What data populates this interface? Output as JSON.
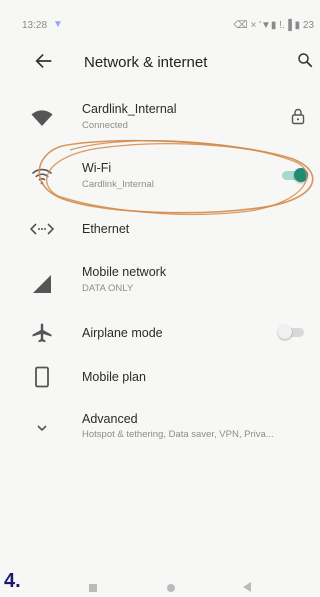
{
  "status_bar": {
    "time": "13:28",
    "right_text": "⌫ × '▼▮ !.▐ ▮ 23"
  },
  "app_bar": {
    "back_icon": "arrow-back-icon",
    "title": "Network & internet",
    "search_icon": "search-icon"
  },
  "items": [
    {
      "title": "Cardlink_Internal",
      "subtitle": "Connected",
      "icon": "wifi-filled-icon",
      "trailing": "lock-icon"
    },
    {
      "title": "Wi-Fi",
      "subtitle": "Cardlink_Internal",
      "icon": "wifi-icon",
      "toggle": true
    },
    {
      "title": "Ethernet",
      "subtitle": "",
      "icon": "ethernet-icon"
    },
    {
      "title": "Mobile network",
      "subtitle": "DATA ONLY",
      "icon": "cellular-signal-icon"
    },
    {
      "title": "Airplane mode",
      "subtitle": "",
      "icon": "airplane-icon",
      "toggle": false
    },
    {
      "title": "Mobile plan",
      "subtitle": "",
      "icon": "phone-outline-icon"
    },
    {
      "title": "Advanced",
      "subtitle": "Hotspot & tethering, Data saver, VPN, Priva...",
      "icon": "chevron-down-icon"
    }
  ],
  "page_number": "4.",
  "colors": {
    "toggle_on_track": "#a8d9cf",
    "toggle_on_thumb": "#1f8b73",
    "toggle_off_track": "#d9d9d9",
    "toggle_off_thumb": "#f0f0f0",
    "annotation_ink": "#d4894a"
  }
}
